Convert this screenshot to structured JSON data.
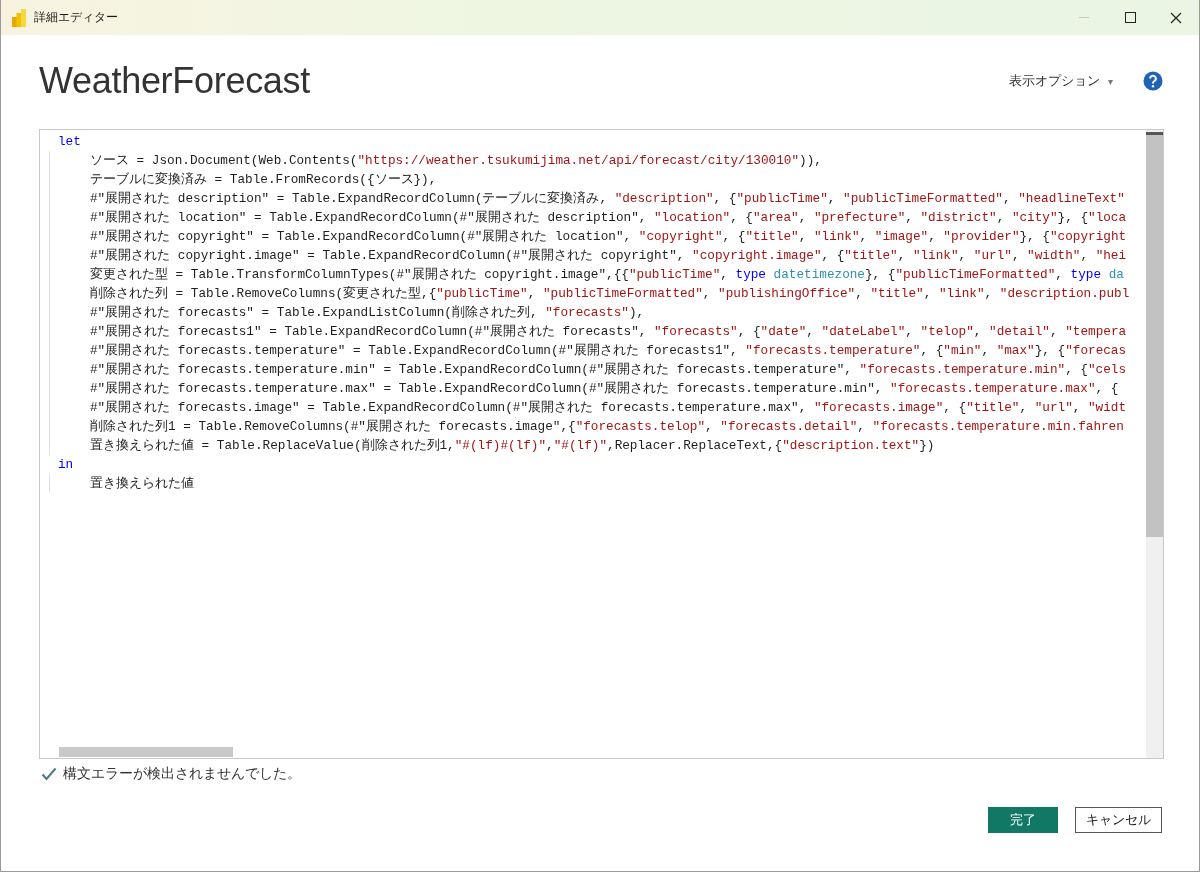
{
  "window": {
    "title": "詳細エディター"
  },
  "heading": "WeatherForecast",
  "display_options": {
    "label": "表示オプション",
    "caret": "▾"
  },
  "editor": {
    "lines": [
      {
        "indented": false,
        "tokens": [
          {
            "kind": "keyword",
            "text": "let"
          }
        ]
      },
      {
        "indented": true,
        "tokens": [
          {
            "kind": "plain",
            "text": "ソース = Json.Document(Web.Contents("
          },
          {
            "kind": "string",
            "text": "\"https://weather.tsukumijima.net/api/forecast/city/130010\""
          },
          {
            "kind": "plain",
            "text": ")),"
          }
        ]
      },
      {
        "indented": true,
        "tokens": [
          {
            "kind": "plain",
            "text": "テーブルに変換済み = Table.FromRecords({ソース}),"
          }
        ]
      },
      {
        "indented": true,
        "tokens": [
          {
            "kind": "plain",
            "text": "#\"展開された description\" = Table.ExpandRecordColumn(テーブルに変換済み, "
          },
          {
            "kind": "string",
            "text": "\"description\""
          },
          {
            "kind": "plain",
            "text": ", {"
          },
          {
            "kind": "string",
            "text": "\"publicTime\""
          },
          {
            "kind": "plain",
            "text": ", "
          },
          {
            "kind": "string",
            "text": "\"publicTimeFormatted\""
          },
          {
            "kind": "plain",
            "text": ", "
          },
          {
            "kind": "string",
            "text": "\"headlineText\""
          }
        ]
      },
      {
        "indented": true,
        "tokens": [
          {
            "kind": "plain",
            "text": "#\"展開された location\" = Table.ExpandRecordColumn(#\"展開された description\", "
          },
          {
            "kind": "string",
            "text": "\"location\""
          },
          {
            "kind": "plain",
            "text": ", {"
          },
          {
            "kind": "string",
            "text": "\"area\""
          },
          {
            "kind": "plain",
            "text": ", "
          },
          {
            "kind": "string",
            "text": "\"prefecture\""
          },
          {
            "kind": "plain",
            "text": ", "
          },
          {
            "kind": "string",
            "text": "\"district\""
          },
          {
            "kind": "plain",
            "text": ", "
          },
          {
            "kind": "string",
            "text": "\"city\""
          },
          {
            "kind": "plain",
            "text": "}, {"
          },
          {
            "kind": "string",
            "text": "\"loca"
          }
        ]
      },
      {
        "indented": true,
        "tokens": [
          {
            "kind": "plain",
            "text": "#\"展開された copyright\" = Table.ExpandRecordColumn(#\"展開された location\", "
          },
          {
            "kind": "string",
            "text": "\"copyright\""
          },
          {
            "kind": "plain",
            "text": ", {"
          },
          {
            "kind": "string",
            "text": "\"title\""
          },
          {
            "kind": "plain",
            "text": ", "
          },
          {
            "kind": "string",
            "text": "\"link\""
          },
          {
            "kind": "plain",
            "text": ", "
          },
          {
            "kind": "string",
            "text": "\"image\""
          },
          {
            "kind": "plain",
            "text": ", "
          },
          {
            "kind": "string",
            "text": "\"provider\""
          },
          {
            "kind": "plain",
            "text": "}, {"
          },
          {
            "kind": "string",
            "text": "\"copyright"
          }
        ]
      },
      {
        "indented": true,
        "tokens": [
          {
            "kind": "plain",
            "text": "#\"展開された copyright.image\" = Table.ExpandRecordColumn(#\"展開された copyright\", "
          },
          {
            "kind": "string",
            "text": "\"copyright.image\""
          },
          {
            "kind": "plain",
            "text": ", {"
          },
          {
            "kind": "string",
            "text": "\"title\""
          },
          {
            "kind": "plain",
            "text": ", "
          },
          {
            "kind": "string",
            "text": "\"link\""
          },
          {
            "kind": "plain",
            "text": ", "
          },
          {
            "kind": "string",
            "text": "\"url\""
          },
          {
            "kind": "plain",
            "text": ", "
          },
          {
            "kind": "string",
            "text": "\"width\""
          },
          {
            "kind": "plain",
            "text": ", "
          },
          {
            "kind": "string",
            "text": "\"hei"
          }
        ]
      },
      {
        "indented": true,
        "tokens": [
          {
            "kind": "plain",
            "text": "変更された型 = Table.TransformColumnTypes(#\"展開された copyright.image\",{{"
          },
          {
            "kind": "string",
            "text": "\"publicTime\""
          },
          {
            "kind": "plain",
            "text": ", "
          },
          {
            "kind": "keyword",
            "text": "type"
          },
          {
            "kind": "typename",
            "text": " datetimezone"
          },
          {
            "kind": "plain",
            "text": "}, {"
          },
          {
            "kind": "string",
            "text": "\"publicTimeFormatted\""
          },
          {
            "kind": "plain",
            "text": ", "
          },
          {
            "kind": "keyword",
            "text": "type"
          },
          {
            "kind": "typename",
            "text": " da"
          }
        ]
      },
      {
        "indented": true,
        "tokens": [
          {
            "kind": "plain",
            "text": "削除された列 = Table.RemoveColumns(変更された型,{"
          },
          {
            "kind": "string",
            "text": "\"publicTime\""
          },
          {
            "kind": "plain",
            "text": ", "
          },
          {
            "kind": "string",
            "text": "\"publicTimeFormatted\""
          },
          {
            "kind": "plain",
            "text": ", "
          },
          {
            "kind": "string",
            "text": "\"publishingOffice\""
          },
          {
            "kind": "plain",
            "text": ", "
          },
          {
            "kind": "string",
            "text": "\"title\""
          },
          {
            "kind": "plain",
            "text": ", "
          },
          {
            "kind": "string",
            "text": "\"link\""
          },
          {
            "kind": "plain",
            "text": ", "
          },
          {
            "kind": "string",
            "text": "\"description.publ"
          }
        ]
      },
      {
        "indented": true,
        "tokens": [
          {
            "kind": "plain",
            "text": "#\"展開された forecasts\" = Table.ExpandListColumn(削除された列, "
          },
          {
            "kind": "string",
            "text": "\"forecasts\""
          },
          {
            "kind": "plain",
            "text": "),"
          }
        ]
      },
      {
        "indented": true,
        "tokens": [
          {
            "kind": "plain",
            "text": "#\"展開された forecasts1\" = Table.ExpandRecordColumn(#\"展開された forecasts\", "
          },
          {
            "kind": "string",
            "text": "\"forecasts\""
          },
          {
            "kind": "plain",
            "text": ", {"
          },
          {
            "kind": "string",
            "text": "\"date\""
          },
          {
            "kind": "plain",
            "text": ", "
          },
          {
            "kind": "string",
            "text": "\"dateLabel\""
          },
          {
            "kind": "plain",
            "text": ", "
          },
          {
            "kind": "string",
            "text": "\"telop\""
          },
          {
            "kind": "plain",
            "text": ", "
          },
          {
            "kind": "string",
            "text": "\"detail\""
          },
          {
            "kind": "plain",
            "text": ", "
          },
          {
            "kind": "string",
            "text": "\"tempera"
          }
        ]
      },
      {
        "indented": true,
        "tokens": [
          {
            "kind": "plain",
            "text": "#\"展開された forecasts.temperature\" = Table.ExpandRecordColumn(#\"展開された forecasts1\", "
          },
          {
            "kind": "string",
            "text": "\"forecasts.temperature\""
          },
          {
            "kind": "plain",
            "text": ", {"
          },
          {
            "kind": "string",
            "text": "\"min\""
          },
          {
            "kind": "plain",
            "text": ", "
          },
          {
            "kind": "string",
            "text": "\"max\""
          },
          {
            "kind": "plain",
            "text": "}, {"
          },
          {
            "kind": "string",
            "text": "\"forecas"
          }
        ]
      },
      {
        "indented": true,
        "tokens": [
          {
            "kind": "plain",
            "text": "#\"展開された forecasts.temperature.min\" = Table.ExpandRecordColumn(#\"展開された forecasts.temperature\", "
          },
          {
            "kind": "string",
            "text": "\"forecasts.temperature.min\""
          },
          {
            "kind": "plain",
            "text": ", {"
          },
          {
            "kind": "string",
            "text": "\"cels"
          }
        ]
      },
      {
        "indented": true,
        "tokens": [
          {
            "kind": "plain",
            "text": "#\"展開された forecasts.temperature.max\" = Table.ExpandRecordColumn(#\"展開された forecasts.temperature.min\", "
          },
          {
            "kind": "string",
            "text": "\"forecasts.temperature.max\""
          },
          {
            "kind": "plain",
            "text": ", {"
          }
        ]
      },
      {
        "indented": true,
        "tokens": [
          {
            "kind": "plain",
            "text": "#\"展開された forecasts.image\" = Table.ExpandRecordColumn(#\"展開された forecasts.temperature.max\", "
          },
          {
            "kind": "string",
            "text": "\"forecasts.image\""
          },
          {
            "kind": "plain",
            "text": ", {"
          },
          {
            "kind": "string",
            "text": "\"title\""
          },
          {
            "kind": "plain",
            "text": ", "
          },
          {
            "kind": "string",
            "text": "\"url\""
          },
          {
            "kind": "plain",
            "text": ", "
          },
          {
            "kind": "string",
            "text": "\"widt"
          }
        ]
      },
      {
        "indented": true,
        "tokens": [
          {
            "kind": "plain",
            "text": "削除された列1 = Table.RemoveColumns(#\"展開された forecasts.image\",{"
          },
          {
            "kind": "string",
            "text": "\"forecasts.telop\""
          },
          {
            "kind": "plain",
            "text": ", "
          },
          {
            "kind": "string",
            "text": "\"forecasts.detail\""
          },
          {
            "kind": "plain",
            "text": ", "
          },
          {
            "kind": "string",
            "text": "\"forecasts.temperature.min.fahren"
          }
        ]
      },
      {
        "indented": true,
        "tokens": [
          {
            "kind": "plain",
            "text": "置き換えられた値 = Table.ReplaceValue(削除された列1,"
          },
          {
            "kind": "string",
            "text": "\"#(lf)#(lf)\""
          },
          {
            "kind": "plain",
            "text": ","
          },
          {
            "kind": "string",
            "text": "\"#(lf)\""
          },
          {
            "kind": "plain",
            "text": ",Replacer.ReplaceText,{"
          },
          {
            "kind": "string",
            "text": "\"description.text\""
          },
          {
            "kind": "plain",
            "text": "})"
          }
        ]
      },
      {
        "indented": false,
        "tokens": [
          {
            "kind": "keyword",
            "text": "in"
          }
        ]
      },
      {
        "indented": true,
        "tokens": [
          {
            "kind": "plain",
            "text": "置き換えられた値"
          }
        ]
      }
    ]
  },
  "status": {
    "ok": true,
    "message": "構文エラーが検出されませんでした。"
  },
  "buttons": [
    {
      "label": "完了",
      "primary": true
    },
    {
      "label": "キャンセル",
      "primary": false
    }
  ]
}
